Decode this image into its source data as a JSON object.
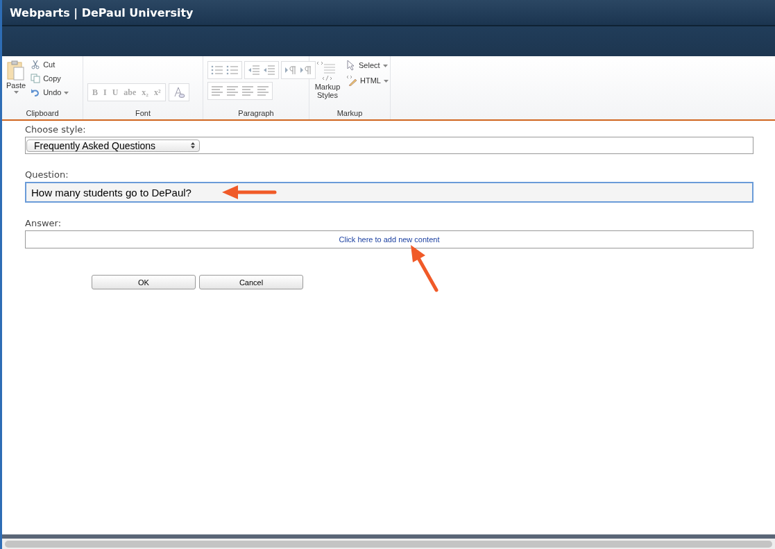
{
  "window": {
    "title": "Webparts | DePaul University"
  },
  "ribbon": {
    "clipboard": {
      "paste": "Paste",
      "cut": "Cut",
      "copy": "Copy",
      "undo": "Undo",
      "label": "Clipboard"
    },
    "font": {
      "buttons": [
        "B",
        "I",
        "U",
        "abe",
        "x₂",
        "x²"
      ],
      "label": "Font"
    },
    "paragraph": {
      "label": "Paragraph"
    },
    "markup": {
      "styles": "Markup Styles",
      "select": "Select",
      "html": "HTML",
      "label": "Markup"
    }
  },
  "form": {
    "style_label": "Choose style:",
    "style_value": "Frequently Asked Questions",
    "question_label": "Question:",
    "question_value": "How many students go to DePaul?",
    "answer_label": "Answer:",
    "answer_link": "Click here to add new content"
  },
  "buttons": [
    "OK",
    "Cancel"
  ]
}
